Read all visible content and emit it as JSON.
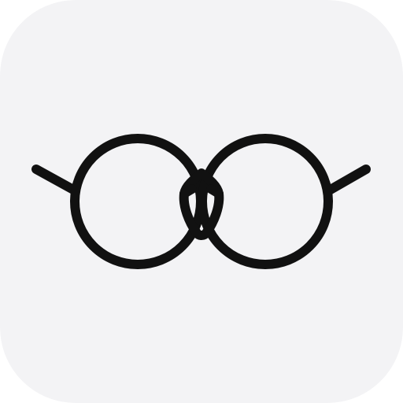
{
  "icon": {
    "name": "glasses-icon",
    "background_color": "#F3F3F5",
    "stroke_color": "#111111"
  }
}
